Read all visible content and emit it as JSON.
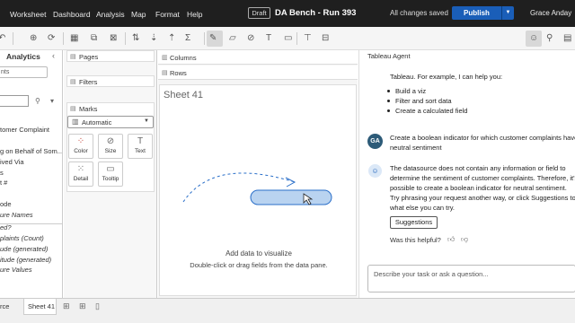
{
  "menu": [
    "Worksheet",
    "Dashboard",
    "Analysis",
    "Map",
    "Format",
    "Help"
  ],
  "header": {
    "badge": "Draft",
    "title": "DA Bench - Run 393",
    "status": "All changes saved",
    "publish_label": "Publish",
    "user_name": "Grace Anday"
  },
  "left_panel": {
    "title": "Analytics",
    "datasource_fragment": "nts",
    "fields": [
      {
        "label": "tomer Complaint",
        "italic": false
      },
      {
        "label": "g on Behalf of Som...",
        "italic": false
      },
      {
        "label": "ived Via",
        "italic": false
      },
      {
        "label": "s",
        "italic": false
      },
      {
        "label": "t #",
        "italic": false
      },
      {
        "label": "ode",
        "italic": false
      },
      {
        "label": "ure Names",
        "italic": true
      },
      {
        "label": "ed?",
        "italic": true
      },
      {
        "label": "plaints (Count)",
        "italic": true
      },
      {
        "label": "ude (generated)",
        "italic": true
      },
      {
        "label": "itude (generated)",
        "italic": true
      },
      {
        "label": "ure Values",
        "italic": true
      }
    ]
  },
  "cards": {
    "pages": "Pages",
    "filters": "Filters",
    "marks": "Marks",
    "mark_type": "Automatic",
    "mark_buttons": [
      "Color",
      "Size",
      "Text",
      "Detail",
      "Tooltip"
    ]
  },
  "shelves": {
    "columns": "Columns",
    "rows": "Rows"
  },
  "sheet": {
    "title": "Sheet 41",
    "hint_main": "Add data to visualize",
    "hint_sub": "Double-click or drag fields from the data pane."
  },
  "agent": {
    "header": "Tableau Agent",
    "intro_line": "Tableau. For example, I can help you:",
    "bullets": [
      "Build a viz",
      "Filter and sort data",
      "Create a calculated field"
    ],
    "user_initials": "GA",
    "user_message_1": "Create a boolean indicator for which customer complaints have",
    "user_message_2": "neutral sentiment",
    "reply_lines": [
      "The datasource does not contain any information or field to",
      "determine the sentiment of customer complaints. Therefore, it's",
      "possible to create a boolean indicator for neutral sentiment.",
      "Try phrasing your request another way, or click Suggestions to",
      "what else you can try."
    ],
    "suggestions_label": "Suggestions",
    "helpful_question": "Was this helpful?",
    "input_placeholder": "Describe your task or ask a question..."
  },
  "bottom": {
    "source_tab_fragment": "rce",
    "active_tab": "Sheet 41"
  },
  "colors": {
    "topbar": "#1f1f1f",
    "publish": "#1a5eb8",
    "user_avatar": "#2d5b78",
    "dashed_arrow": "#2a6fc9",
    "pill": "#b9d3f0"
  }
}
